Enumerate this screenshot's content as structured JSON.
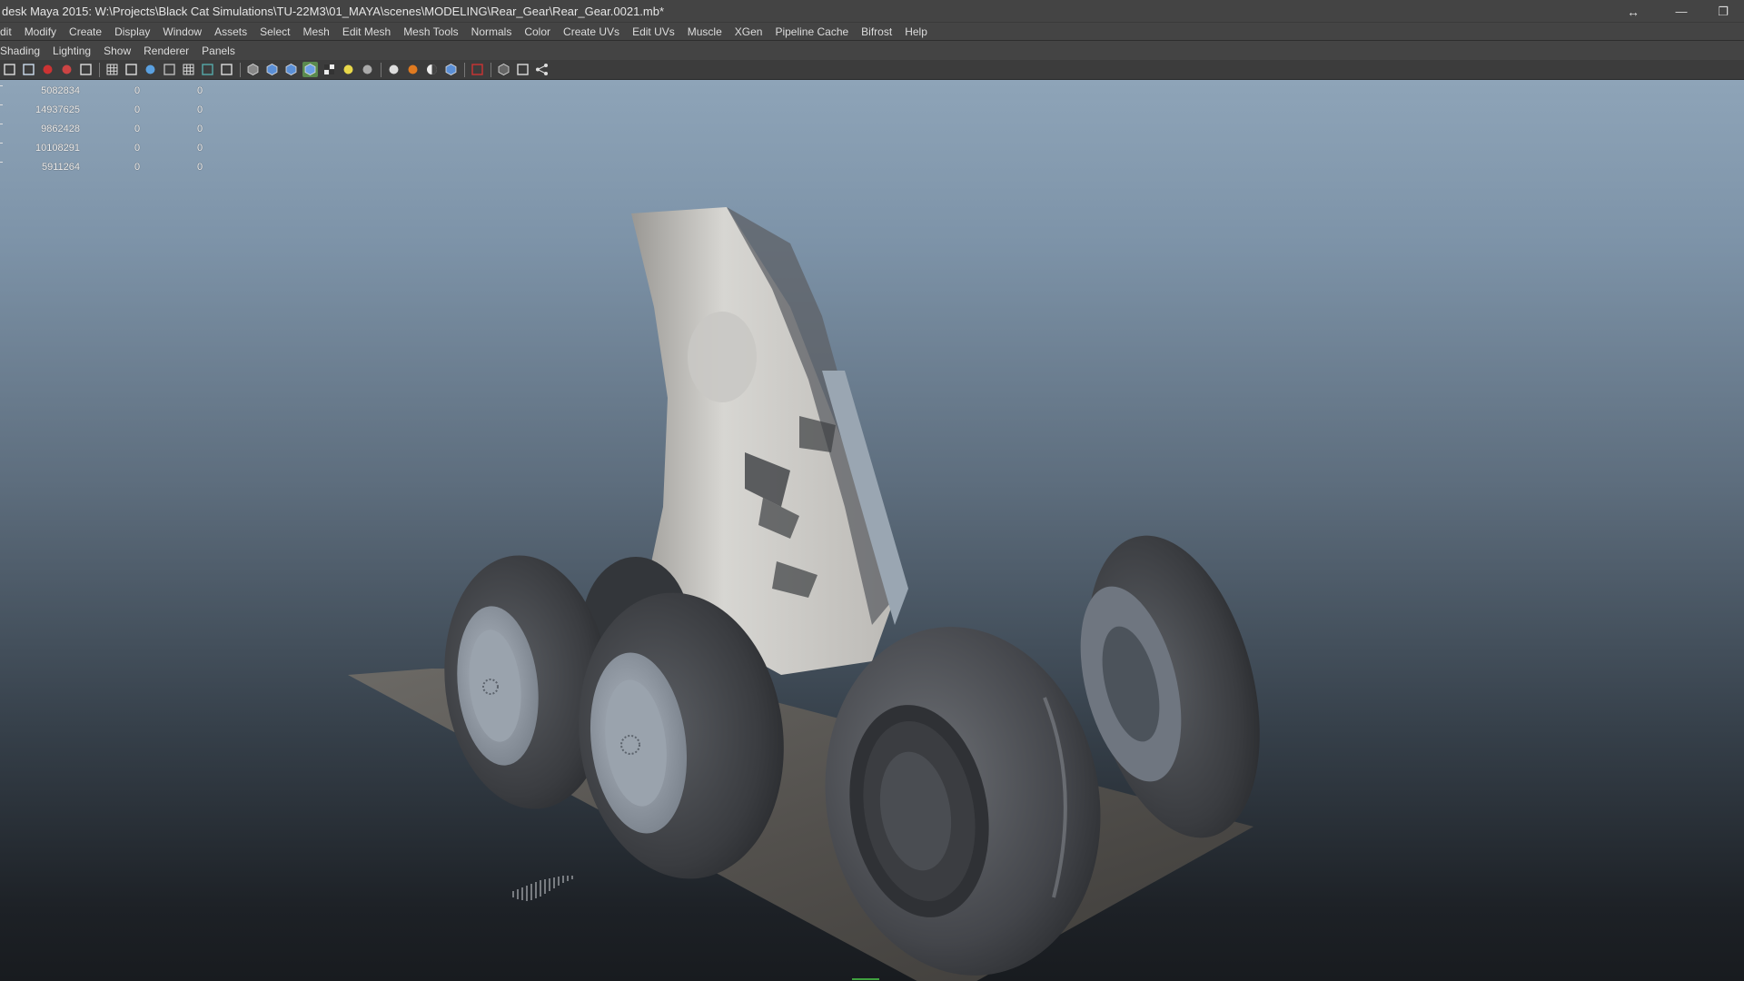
{
  "window": {
    "title": "desk Maya 2015: W:\\Projects\\Black Cat Simulations\\TU-22M3\\01_MAYA\\scenes\\MODELING\\Rear_Gear\\Rear_Gear.0021.mb*",
    "controls": {
      "resize": "↔",
      "minimize": "—",
      "restore": "❐"
    }
  },
  "main_menu": [
    "dit",
    "Modify",
    "Create",
    "Display",
    "Window",
    "Assets",
    "Select",
    "Mesh",
    "Edit Mesh",
    "Mesh Tools",
    "Normals",
    "Color",
    "Create UVs",
    "Edit UVs",
    "Muscle",
    "XGen",
    "Pipeline Cache",
    "Bifrost",
    "Help"
  ],
  "panel_menu": [
    "Shading",
    "Lighting",
    "Show",
    "Renderer",
    "Panels"
  ],
  "toolbar_icons": [
    "camera-attributes-icon",
    "bookmarks-icon",
    "image-plane-icon",
    "2d-pan-zoom-icon",
    "grease-pencil-icon",
    "grid-icon",
    "film-gate-icon",
    "resolution-gate-icon",
    "gate-mask-icon",
    "field-chart-icon",
    "safe-action-icon",
    "safe-title-icon",
    "wireframe-icon",
    "smooth-shade-icon",
    "wireframe-on-shaded-icon",
    "default-material-icon",
    "textured-icon",
    "use-all-lights-icon",
    "shadows-icon",
    "screen-space-ao-icon",
    "motion-blur-icon",
    "multisample-aa-icon",
    "depth-of-field-icon",
    "isolate-select-icon",
    "xray-icon",
    "xray-joints-icon",
    "xray-active-icon"
  ],
  "hud": {
    "rows": [
      {
        "c1": "5082834",
        "c2": "0",
        "c3": "0"
      },
      {
        "c1": "14937625",
        "c2": "0",
        "c3": "0"
      },
      {
        "c1": "9862428",
        "c2": "0",
        "c3": "0"
      },
      {
        "c1": "10108291",
        "c2": "0",
        "c3": "0"
      },
      {
        "c1": "5911264",
        "c2": "0",
        "c3": "0"
      }
    ]
  }
}
